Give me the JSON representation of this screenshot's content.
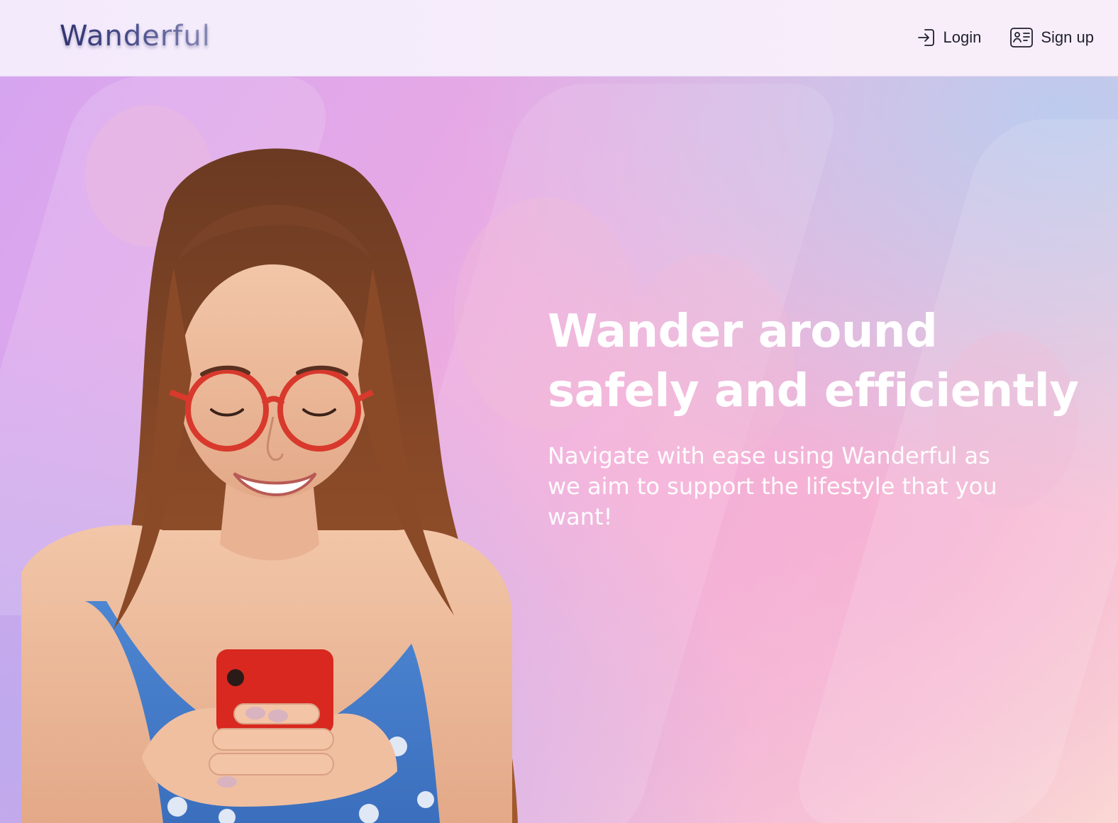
{
  "header": {
    "logo_text": "Wanderful",
    "nav": [
      {
        "label": "Login",
        "icon": "login-icon"
      },
      {
        "label": "Sign up",
        "icon": "id-card-icon"
      }
    ]
  },
  "hero": {
    "headline_line1": "Wander around",
    "headline_line2": "safely and efficiently",
    "subtext": "Navigate with ease using Wanderful as we aim to support the lifestyle that you want!",
    "image": "woman-smiling-at-phone-photo"
  },
  "colors": {
    "logo": "#353a7a",
    "gradient_start": "#d6a5f0",
    "gradient_mid": "#f2b2dd",
    "gradient_end": "#fad9d4",
    "headline": "#ffffff"
  }
}
